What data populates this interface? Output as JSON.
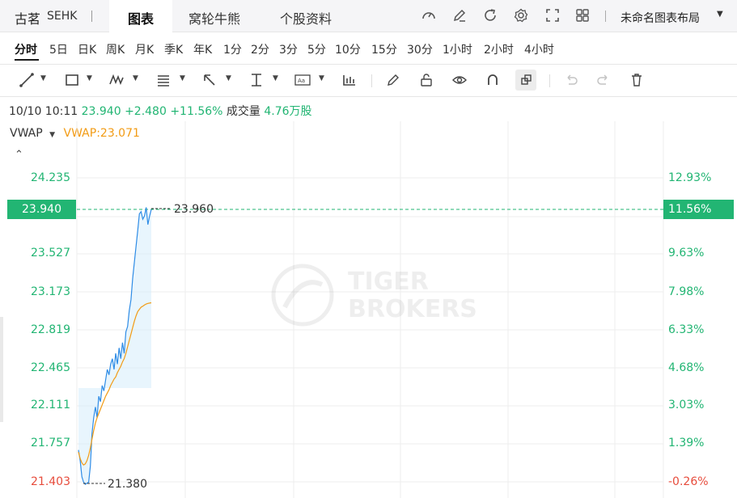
{
  "header": {
    "stock_name": "古茗",
    "stock_code": "SEHK",
    "tabs": [
      {
        "label": "图表",
        "active": true
      },
      {
        "label": "窝轮牛熊",
        "active": false
      },
      {
        "label": "个股资料",
        "active": false
      }
    ],
    "layout_name": "未命名图表布局"
  },
  "periods": [
    "分时",
    "5日",
    "日K",
    "周K",
    "月K",
    "季K",
    "年K",
    "1分",
    "2分",
    "3分",
    "5分",
    "10分",
    "15分",
    "30分",
    "1小时",
    "2小时",
    "4小时"
  ],
  "active_period": "分时",
  "quote": {
    "datetime": "10/10 10:11",
    "price": "23.940",
    "change": "+2.480",
    "change_pct": "+11.56%",
    "volume_label": "成交量",
    "volume": "4.76万股"
  },
  "vwap": {
    "label": "VWAP",
    "value": "VWAP:23.071"
  },
  "price_axis": [
    "24.235",
    "23.527",
    "23.173",
    "22.819",
    "22.465",
    "22.111",
    "21.757",
    "21.403"
  ],
  "pct_axis": [
    "12.93%",
    "9.63%",
    "7.98%",
    "6.33%",
    "4.68%",
    "3.03%",
    "1.39%",
    "-0.26%"
  ],
  "current_price_tag": "23.940",
  "current_pct_tag": "11.56%",
  "high_label": "23.960",
  "low_label": "21.380",
  "watermark": [
    "TIGER",
    "BROKERS"
  ],
  "colors": {
    "up": "#22b573",
    "down": "#e74c3c",
    "price_line": "#2e8ce6",
    "vwap_line": "#f29b14"
  },
  "chart_data": {
    "type": "line",
    "x_label": "",
    "y_label": "",
    "ylim": [
      21.3,
      24.4
    ],
    "series": [
      {
        "name": "",
        "values": [
          21.7,
          21.6,
          21.45,
          21.4,
          21.38,
          21.39,
          21.4,
          21.55,
          21.85,
          22.0,
          22.1,
          22.0,
          22.2,
          22.15,
          22.3,
          22.25,
          22.35,
          22.45,
          22.4,
          22.5,
          22.55,
          22.45,
          22.6,
          22.5,
          22.65,
          22.55,
          22.7,
          22.6,
          22.8,
          22.85,
          23.0,
          23.1,
          23.3,
          23.45,
          23.6,
          23.75,
          23.9,
          23.92,
          23.85,
          23.88,
          23.96,
          23.8,
          23.88,
          23.94
        ]
      },
      {
        "name": "VWAP",
        "values": [
          21.68,
          21.62,
          21.58,
          21.56,
          21.57,
          21.6,
          21.65,
          21.72,
          21.8,
          21.88,
          21.95,
          22.0,
          22.04,
          22.08,
          22.12,
          22.16,
          22.2,
          22.23,
          22.26,
          22.3,
          22.33,
          22.36,
          22.38,
          22.42,
          22.45,
          22.48,
          22.52,
          22.55,
          22.6,
          22.66,
          22.72,
          22.78,
          22.84,
          22.9,
          22.95,
          22.99,
          23.01,
          23.03,
          23.04,
          23.05,
          23.06,
          23.065,
          23.068,
          23.071
        ]
      }
    ]
  }
}
